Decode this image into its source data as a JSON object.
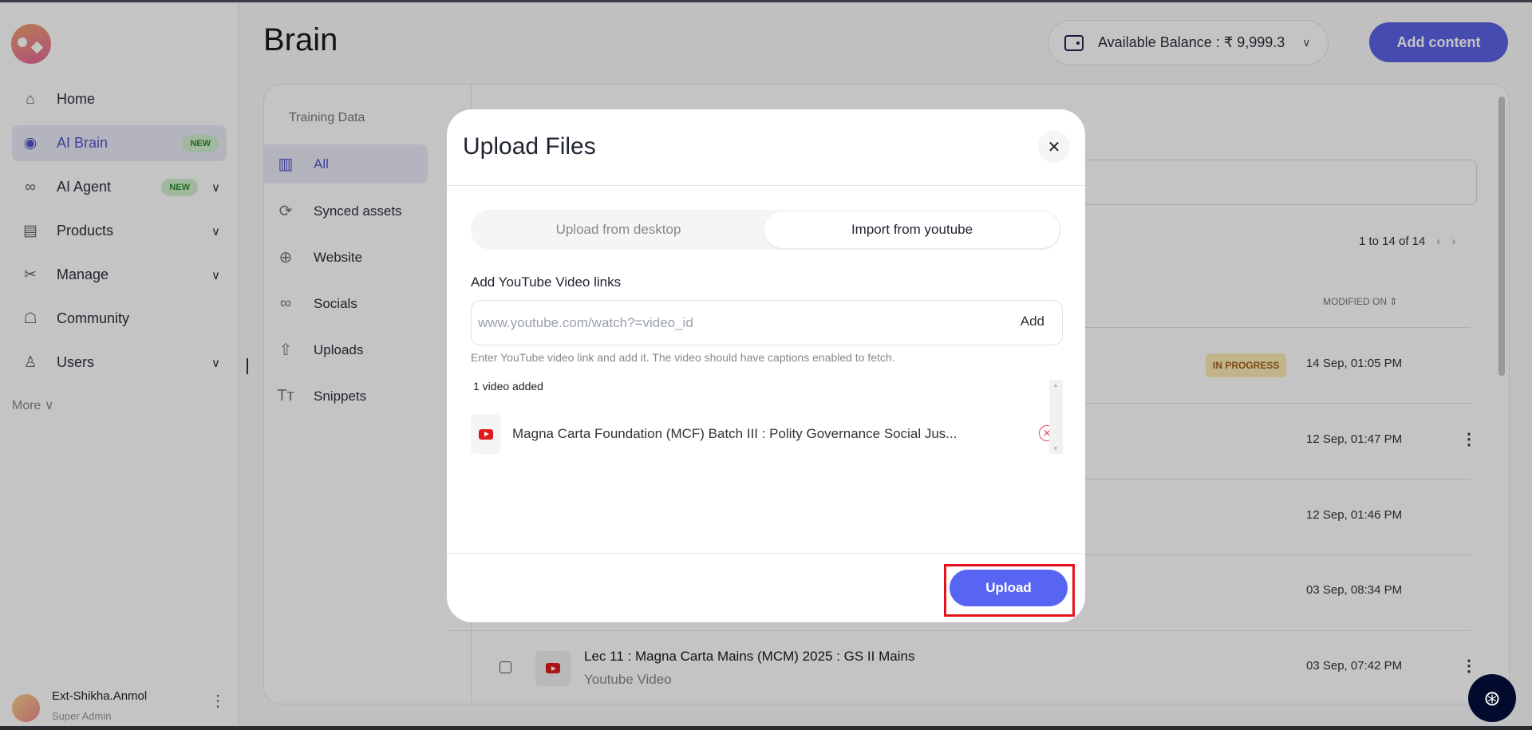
{
  "sidebar": {
    "items": [
      {
        "label": "Home",
        "icon": "home-icon"
      },
      {
        "label": "AI Brain",
        "icon": "brain-icon",
        "badge": "NEW"
      },
      {
        "label": "AI Agent",
        "icon": "infinity-icon",
        "badge": "NEW"
      },
      {
        "label": "Products",
        "icon": "archive-icon"
      },
      {
        "label": "Manage",
        "icon": "tools-icon"
      },
      {
        "label": "Community",
        "icon": "chat-icon"
      },
      {
        "label": "Users",
        "icon": "user-icon"
      }
    ],
    "more": "More",
    "user": {
      "name": "Ext-Shikha.Anmol",
      "role": "Super Admin"
    }
  },
  "header": {
    "title": "Brain",
    "balance": "Available Balance : ₹ 9,999.3",
    "add_content": "Add content"
  },
  "training": {
    "label": "Training Data",
    "items": [
      "All",
      "Synced assets",
      "Website",
      "Socials",
      "Uploads",
      "Snippets"
    ]
  },
  "table": {
    "pagination": "1 to 14 of 14",
    "modified_header": "MODIFIED ON",
    "status_in_progress": "IN PROGRESS",
    "dates": [
      "14 Sep, 01:05 PM",
      "12 Sep, 01:47 PM",
      "12 Sep, 01:46 PM",
      "03 Sep, 08:34 PM",
      "03 Sep, 07:42 PM"
    ],
    "last_row": {
      "title": "Lec 11 : Magna Carta Mains (MCM) 2025 : GS II Mains",
      "type": "Youtube Video"
    }
  },
  "modal": {
    "title": "Upload Files",
    "close": "✕",
    "tabs": [
      "Upload from desktop",
      "Import from youtube"
    ],
    "label": "Add YouTube Video links",
    "placeholder": "www.youtube.com/watch?=video_id",
    "add": "Add",
    "hint": "Enter YouTube video link and add it. The video should have captions enabled to fetch.",
    "count": "1 video added",
    "video_title": "Magna Carta Foundation (MCF) Batch III : Polity Governance Social Jus...",
    "upload": "Upload"
  },
  "colors": {
    "accent": "#5c62e6",
    "highlight": "#e5121a"
  }
}
